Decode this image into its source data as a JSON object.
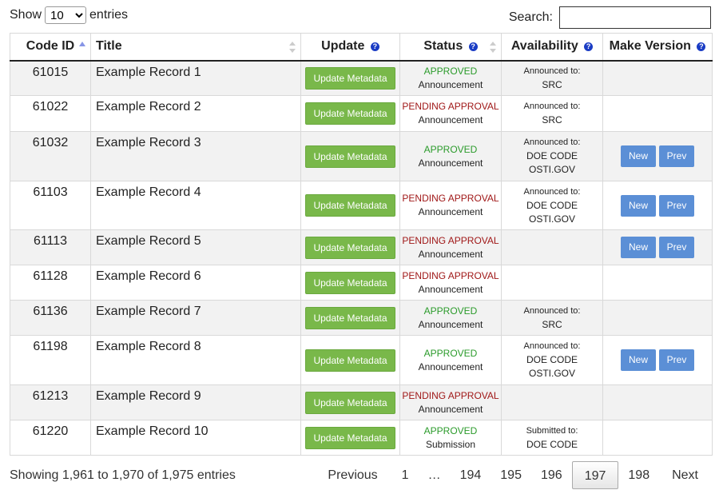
{
  "length_menu": {
    "prefix": "Show",
    "value": "10",
    "suffix": "entries",
    "options": [
      "10"
    ]
  },
  "search": {
    "label": "Search:",
    "value": ""
  },
  "columns": {
    "code_id": "Code ID",
    "title": "Title",
    "update": "Update",
    "status": "Status",
    "availability": "Availability",
    "make_version": "Make Version",
    "help_glyph": "?"
  },
  "rows": [
    {
      "code_id": "61015",
      "title": "Example Record 1",
      "update_label": "Update Metadata",
      "status": "APPROVED",
      "status_color": "#2b9b2b",
      "status_type": "Announcement",
      "avail_label": "Announced to:",
      "avail_lines": [
        "SRC"
      ],
      "has_version": false
    },
    {
      "code_id": "61022",
      "title": "Example Record 2",
      "update_label": "Update Metadata",
      "status": "PENDING APPROVAL",
      "status_color": "#a01818",
      "status_type": "Announcement",
      "avail_label": "Announced to:",
      "avail_lines": [
        "SRC"
      ],
      "has_version": false
    },
    {
      "code_id": "61032",
      "title": "Example Record 3",
      "update_label": "Update Metadata",
      "status": "APPROVED",
      "status_color": "#2b9b2b",
      "status_type": "Announcement",
      "avail_label": "Announced to:",
      "avail_lines": [
        "DOE CODE",
        "OSTI.GOV"
      ],
      "has_version": true
    },
    {
      "code_id": "61103",
      "title": "Example Record 4",
      "update_label": "Update Metadata",
      "status": "PENDING APPROVAL",
      "status_color": "#a01818",
      "status_type": "Announcement",
      "avail_label": "Announced to:",
      "avail_lines": [
        "DOE CODE",
        "OSTI.GOV"
      ],
      "has_version": true
    },
    {
      "code_id": "61113",
      "title": "Example Record 5",
      "update_label": "Update Metadata",
      "status": "PENDING APPROVAL",
      "status_color": "#a01818",
      "status_type": "Announcement",
      "avail_label": "",
      "avail_lines": [],
      "has_version": true
    },
    {
      "code_id": "61128",
      "title": "Example Record 6",
      "update_label": "Update Metadata",
      "status": "PENDING APPROVAL",
      "status_color": "#a01818",
      "status_type": "Announcement",
      "avail_label": "",
      "avail_lines": [],
      "has_version": false
    },
    {
      "code_id": "61136",
      "title": "Example Record 7",
      "update_label": "Update Metadata",
      "status": "APPROVED",
      "status_color": "#2b9b2b",
      "status_type": "Announcement",
      "avail_label": "Announced to:",
      "avail_lines": [
        "SRC"
      ],
      "has_version": false
    },
    {
      "code_id": "61198",
      "title": "Example Record 8",
      "update_label": "Update Metadata",
      "status": "APPROVED",
      "status_color": "#2b9b2b",
      "status_type": "Announcement",
      "avail_label": "Announced to:",
      "avail_lines": [
        "DOE CODE",
        "OSTI.GOV"
      ],
      "has_version": true
    },
    {
      "code_id": "61213",
      "title": "Example Record 9",
      "update_label": "Update Metadata",
      "status": "PENDING APPROVAL",
      "status_color": "#a01818",
      "status_type": "Announcement",
      "avail_label": "",
      "avail_lines": [],
      "has_version": false
    },
    {
      "code_id": "61220",
      "title": "Example Record 10",
      "update_label": "Update Metadata",
      "status": "APPROVED",
      "status_color": "#2b9b2b",
      "status_type": "Submission",
      "avail_label": "Submitted to:",
      "avail_lines": [
        "DOE CODE"
      ],
      "has_version": false
    }
  ],
  "version_buttons": {
    "new": "New",
    "prev": "Prev"
  },
  "footer": {
    "info": "Showing 1,961 to 1,970 of 1,975 entries",
    "pages": [
      "Previous",
      "1",
      "…",
      "194",
      "195",
      "196",
      "197",
      "198",
      "Next"
    ],
    "current_page": "197"
  },
  "colors": {
    "update_button": "#79b84a",
    "version_button": "#5b8fd6",
    "approved": "#2b9b2b",
    "pending": "#a01818",
    "help_icon": "#1a3cc4"
  }
}
